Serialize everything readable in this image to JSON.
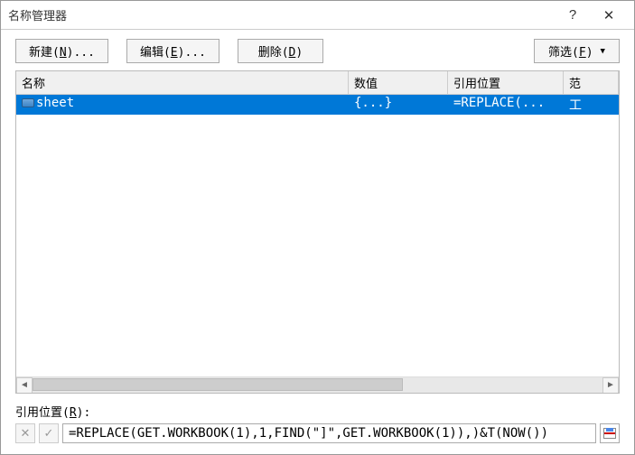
{
  "titlebar": {
    "title": "名称管理器",
    "help": "?",
    "close": "✕"
  },
  "toolbar": {
    "new_label": "新建(N)...",
    "edit_label": "编辑(E)...",
    "delete_label": "删除(D)",
    "filter_label": "筛选(F)"
  },
  "list": {
    "headers": {
      "name": "名称",
      "value": "数值",
      "ref": "引用位置",
      "scope": "范"
    },
    "rows": [
      {
        "name": "sheet",
        "value": "{...}",
        "ref": "=REPLACE(...",
        "scope": "工"
      }
    ]
  },
  "ref_section": {
    "label": "引用位置(R):",
    "value": "=REPLACE(GET.WORKBOOK(1),1,FIND(\"]\",GET.WORKBOOK(1)),)&T(NOW())",
    "cancel_icon": "✕",
    "confirm_icon": "✓"
  }
}
